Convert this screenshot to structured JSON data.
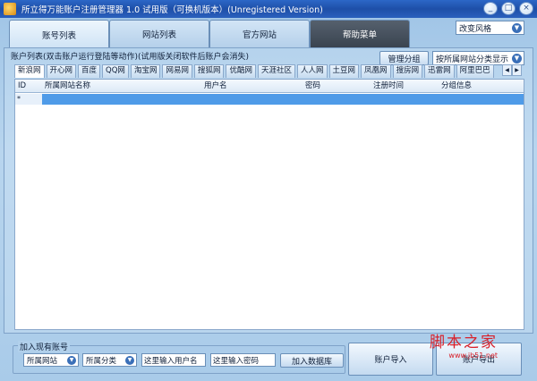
{
  "window": {
    "title": "所立得万能账户注册管理器 1.0  试用版（可换机版本）(Unregistered Version)",
    "buttons": [
      "_",
      "□",
      "×"
    ]
  },
  "main_tabs": [
    {
      "label": "账号列表"
    },
    {
      "label": "网站列表"
    },
    {
      "label": "官方网站"
    },
    {
      "label": "帮助菜单"
    }
  ],
  "style_select": {
    "value": "改变风格"
  },
  "accounts": {
    "caption": "账户列表(双击账户运行登陆等动作)(试用版关闭软件后账户会消失)",
    "manage_label": "管理分组",
    "group_select": "按所属网站分类显示"
  },
  "site_tabs": [
    "新浪网",
    "开心网",
    "百度",
    "QQ网",
    "淘宝网",
    "网易网",
    "搜狐网",
    "优酷网",
    "天涯社区",
    "人人网",
    "土豆网",
    "凤凰网",
    "搜房网",
    "迅雷网",
    "阿里巴巴"
  ],
  "scroll_arrows": [
    "◀",
    "▶"
  ],
  "grid": {
    "columns": [
      "ID",
      "所属网站名称",
      "用户名",
      "密码",
      "注册时间",
      "分组信息"
    ],
    "row_marker": "*"
  },
  "add_account": {
    "caption": "加入现有账号",
    "site_select": "所属网站",
    "category_select": "所属分类",
    "username_value": "这里输入用户名",
    "password_value": "这里输入密码",
    "add_button": "加入数据库"
  },
  "import_button": "账户导入",
  "export_button": "账户导出",
  "watermark": {
    "text": "脚本之家",
    "url": "www.jb51.net"
  }
}
